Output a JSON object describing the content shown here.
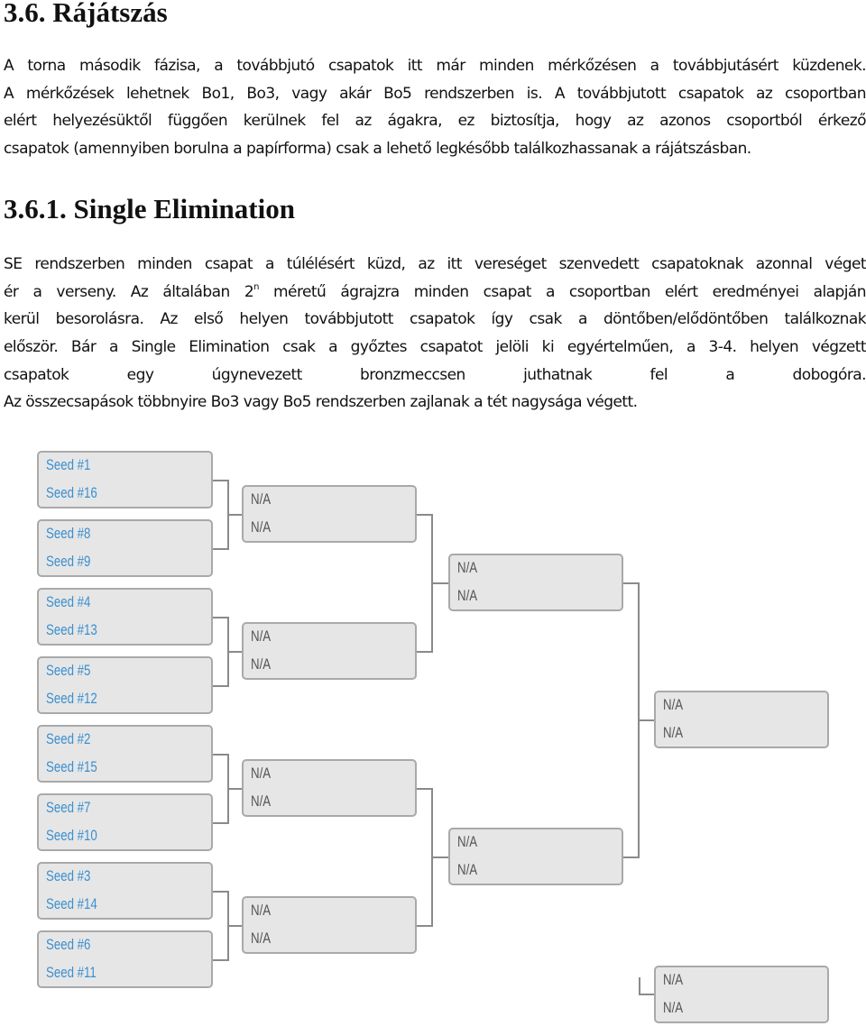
{
  "section": {
    "title": "3.6. Rájátszás",
    "paragraph_lines": [
      "A torna második fázisa, a továbbjutó csapatok itt már minden mérkőzésen a továbbjutásért küzdenek.",
      "A mérkőzések lehetnek Bo1, Bo3, vagy akár Bo5 rendszerben is. A továbbjutott csapatok az csoportban",
      "elért helyezésüktől függően kerülnek fel az ágakra, ez biztosítja, hogy az azonos csoportból érkező",
      "csapatok (amennyiben borulna a papírforma) csak a lehető legkésőbb találkozhassanak a rájátszásban."
    ]
  },
  "subsection": {
    "title": "3.6.1. Single Elimination",
    "paragraph_lines": [
      "SE rendszerben minden csapat a túlélésért küzd, az itt vereséget szenvedett csapatoknak azonnal véget",
      {
        "before": "ér a verseny. Az általában 2",
        "sup": "n",
        "after": " méretű ágrajzra minden csapat a csoportban elért eredményei alapján"
      },
      "kerül besorolásra. Az első helyen továbbjutott csapatok így csak a döntőben/elődöntőben találkoznak",
      "először. Bár a Single Elimination csak a győztes csapatot jelöli ki egyértelműen, a 3-4. helyen végzett",
      "csapatok egy úgynevezett bronzmeccsen juthatnak fel a dobogóra.",
      "Az összecsapások többnyire Bo3 vagy Bo5 rendszerben zajlanak a tét nagysága végett."
    ]
  },
  "bracket": {
    "colors": {
      "seed_text": "#3a8fd0",
      "na_text": "#555555",
      "box_fill": "#e6e6e6",
      "box_border": "#a9a9a9",
      "connector": "#8a8a8a"
    },
    "rounds": [
      {
        "name": "round-of-16",
        "matches": [
          [
            "Seed #1",
            "Seed #16"
          ],
          [
            "Seed #8",
            "Seed #9"
          ],
          [
            "Seed #4",
            "Seed #13"
          ],
          [
            "Seed #5",
            "Seed #12"
          ],
          [
            "Seed #2",
            "Seed #15"
          ],
          [
            "Seed #7",
            "Seed #10"
          ],
          [
            "Seed #3",
            "Seed #14"
          ],
          [
            "Seed #6",
            "Seed #11"
          ]
        ]
      },
      {
        "name": "quarterfinals",
        "matches": [
          [
            "N/A",
            "N/A"
          ],
          [
            "N/A",
            "N/A"
          ],
          [
            "N/A",
            "N/A"
          ],
          [
            "N/A",
            "N/A"
          ]
        ]
      },
      {
        "name": "semifinals",
        "matches": [
          [
            "N/A",
            "N/A"
          ],
          [
            "N/A",
            "N/A"
          ]
        ]
      },
      {
        "name": "final",
        "matches": [
          [
            "N/A",
            "N/A"
          ]
        ]
      },
      {
        "name": "bronze-match",
        "matches": [
          [
            "N/A",
            "N/A"
          ]
        ]
      }
    ]
  }
}
